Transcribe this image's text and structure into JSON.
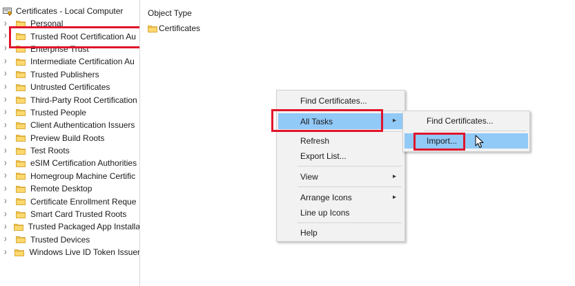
{
  "tree": {
    "root_label": "Certificates - Local Computer",
    "items": [
      {
        "label": "Personal"
      },
      {
        "label": "Trusted Root Certification Au"
      },
      {
        "label": "Enterprise Trust"
      },
      {
        "label": "Intermediate Certification Au"
      },
      {
        "label": "Trusted Publishers"
      },
      {
        "label": "Untrusted Certificates"
      },
      {
        "label": "Third-Party Root Certification"
      },
      {
        "label": "Trusted People"
      },
      {
        "label": "Client Authentication Issuers"
      },
      {
        "label": "Preview Build Roots"
      },
      {
        "label": "Test Roots"
      },
      {
        "label": "eSIM Certification Authorities"
      },
      {
        "label": "Homegroup Machine Certific"
      },
      {
        "label": "Remote Desktop"
      },
      {
        "label": "Certificate Enrollment Reque"
      },
      {
        "label": "Smart Card Trusted Roots"
      },
      {
        "label": "Trusted Packaged App Installa"
      },
      {
        "label": "Trusted Devices"
      },
      {
        "label": "Windows Live ID Token Issuer"
      }
    ]
  },
  "content": {
    "column_header": "Object Type",
    "rows": [
      {
        "label": "Certificates"
      }
    ]
  },
  "context_menu": {
    "find": "Find Certificates...",
    "all_tasks": "All Tasks",
    "refresh": "Refresh",
    "export": "Export List...",
    "view": "View",
    "arrange": "Arrange Icons",
    "lineup": "Line up Icons",
    "help": "Help"
  },
  "submenu": {
    "find": "Find Certificates...",
    "import": "Import..."
  },
  "colors": {
    "highlight_border": "#e0142a",
    "menu_hot": "#91c9f7",
    "folder": "#f5c542"
  }
}
